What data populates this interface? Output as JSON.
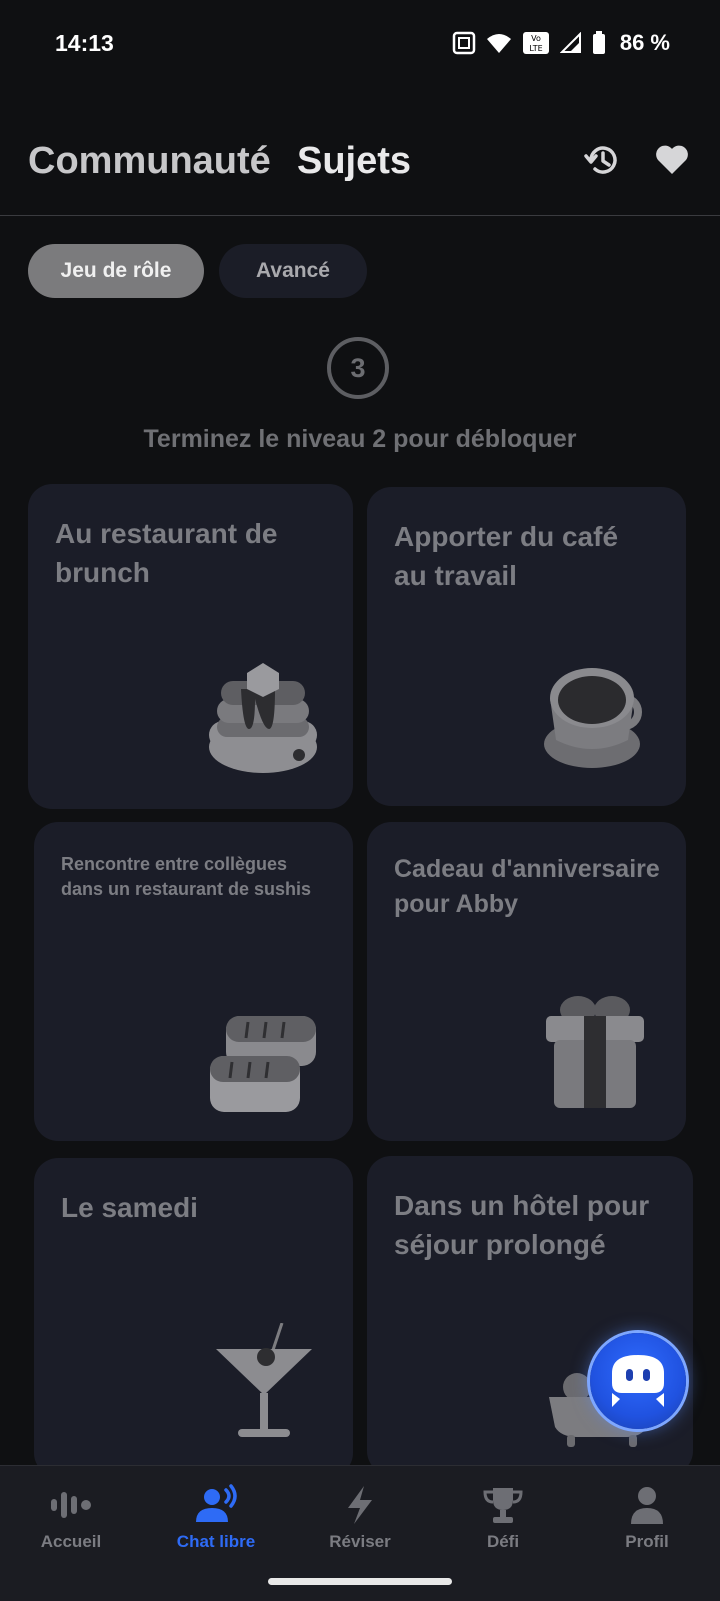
{
  "status_bar": {
    "time": "14:13",
    "battery": "86 %"
  },
  "header": {
    "tab_community": "Communauté",
    "tab_topics": "Sujets",
    "history_icon": "history-icon",
    "favorites_icon": "heart-icon"
  },
  "filters": {
    "active": "Jeu de rôle",
    "inactive": "Avancé"
  },
  "level": {
    "number": "3",
    "message": "Terminez le niveau 2 pour débloquer"
  },
  "cards": [
    {
      "title": "Au restaurant de brunch",
      "icon": "pancake-stack-icon"
    },
    {
      "title": "Apporter du café au travail",
      "icon": "coffee-cup-icon"
    },
    {
      "title": "Rencontre entre collègues dans un restaurant de sushis",
      "icon": "sushi-icon"
    },
    {
      "title": "Cadeau d'anniversaire pour Abby",
      "icon": "gift-box-icon"
    },
    {
      "title": "Le samedi",
      "icon": "cocktail-glass-icon"
    },
    {
      "title": "Dans un hôtel pour séjour prolongé",
      "icon": "bathtub-icon"
    }
  ],
  "assistant": {
    "icon": "robot-assistant-icon"
  },
  "nav": [
    {
      "label": "Accueil",
      "icon": "voice-wave-icon"
    },
    {
      "label": "Chat libre",
      "icon": "speaking-person-icon",
      "active": true
    },
    {
      "label": "Réviser",
      "icon": "lightning-icon"
    },
    {
      "label": "Défi",
      "icon": "trophy-icon"
    },
    {
      "label": "Profil",
      "icon": "person-icon"
    }
  ],
  "colors": {
    "accent": "#2e6bf5",
    "card_bg": "#1b1d28",
    "background": "#0f1012"
  }
}
